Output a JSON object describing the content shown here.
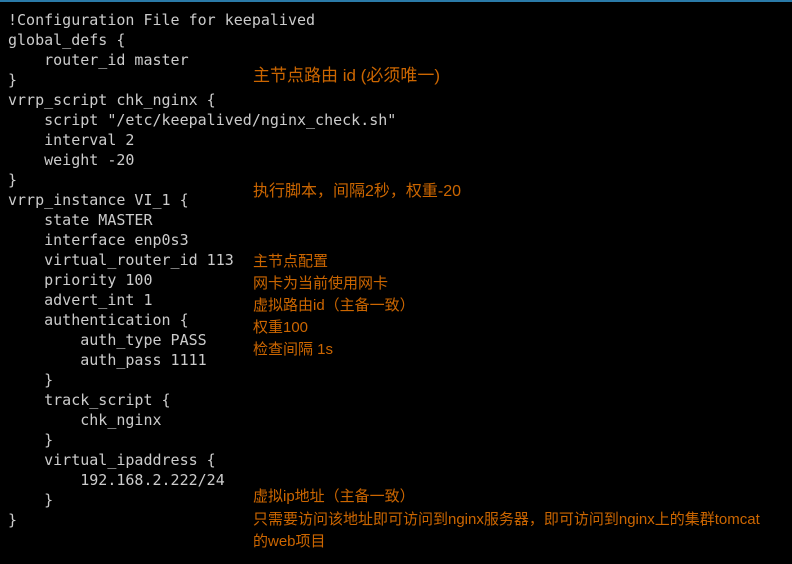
{
  "config": {
    "l1": "!Configuration File for keepalived",
    "l2": "",
    "l3": "global_defs {",
    "l4": "    router_id master",
    "l5": "}",
    "l6": "",
    "l7": "vrrp_script chk_nginx {",
    "l8": "    script \"/etc/keepalived/nginx_check.sh\"",
    "l9": "    interval 2",
    "l10": "    weight -20",
    "l11": "}",
    "l12": "",
    "l13": "vrrp_instance VI_1 {",
    "l14": "    state MASTER",
    "l15": "    interface enp0s3",
    "l16": "    virtual_router_id 113",
    "l17": "    priority 100",
    "l18": "    advert_int 1",
    "l19": "    authentication {",
    "l20": "        auth_type PASS",
    "l21": "        auth_pass 1111",
    "l22": "    }",
    "l23": "    track_script {",
    "l24": "        chk_nginx",
    "l25": "    }",
    "l26": "    virtual_ipaddress {",
    "l27": "        192.168.2.222/24",
    "l28": "    }",
    "l29": "}"
  },
  "annotations": {
    "router_id": "主节点路由 id (必须唯一)",
    "script_desc": "执行脚本，间隔2秒，权重-20",
    "master": "主节点配置",
    "interface": "网卡为当前使用网卡",
    "vrid": "虚拟路由id（主备一致）",
    "priority": "权重100",
    "advert": "检查间隔 1s",
    "vip": "虚拟ip地址（主备一致）",
    "vip_desc": "只需要访问该地址即可访问到nginx服务器，即可访问到nginx上的集群tomcat的web项目"
  }
}
